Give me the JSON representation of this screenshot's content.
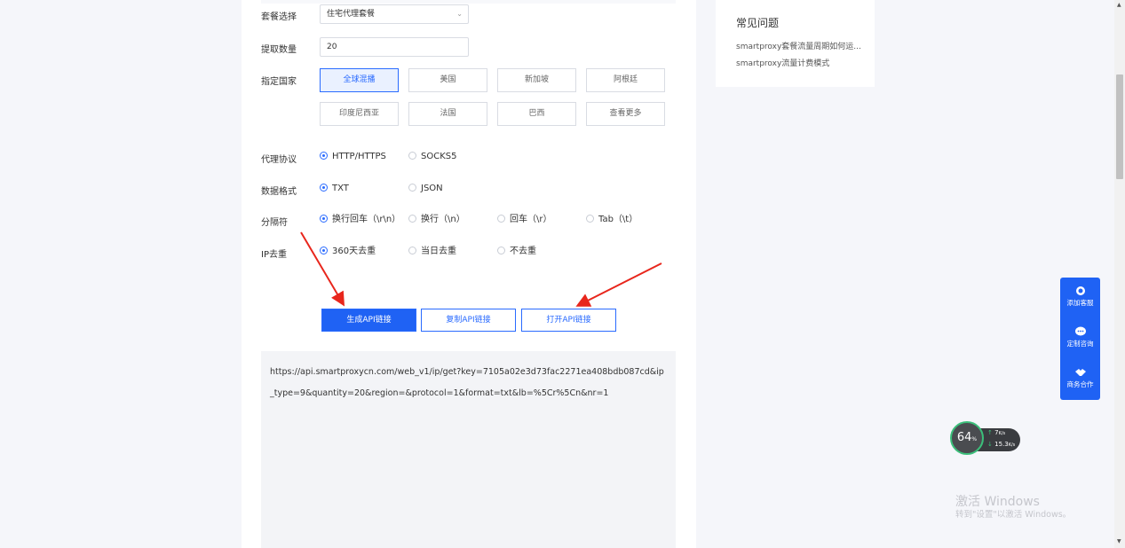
{
  "form": {
    "package_label": "套餐选择",
    "package_value": "住宅代理套餐",
    "qty_label": "提取数量",
    "qty_value": "20",
    "country_label": "指定国家",
    "countries": [
      "全球混播",
      "美国",
      "新加坡",
      "阿根廷",
      "印度尼西亚",
      "法国",
      "巴西",
      "查看更多"
    ],
    "protocol_label": "代理协议",
    "protocol_options": [
      "HTTP/HTTPS",
      "SOCKS5"
    ],
    "format_label": "数据格式",
    "format_options": [
      "TXT",
      "JSON"
    ],
    "separator_label": "分隔符",
    "separator_options": [
      "换行回车（\\r\\n）",
      "换行（\\n）",
      "回车（\\r）",
      "Tab（\\t）"
    ],
    "dedup_label": "IP去重",
    "dedup_options": [
      "360天去重",
      "当日去重",
      "不去重"
    ]
  },
  "actions": {
    "generate": "生成API链接",
    "copy": "复制API链接",
    "open": "打开API链接"
  },
  "result_url": "https://api.smartproxycn.com/web_v1/ip/get?key=7105a02e3d73fac2271ea408bdb087cd&ip_type=9&quantity=20&region=&protocol=1&format=txt&lb=%5Cr%5Cn&nr=1",
  "faq": {
    "title": "常见问题",
    "items": [
      "smartproxy套餐流量周期如何运...",
      "smartproxy流量计费模式"
    ]
  },
  "float_menu": [
    "添加客服",
    "定制咨询",
    "商务合作"
  ],
  "gauge": {
    "percent": "64",
    "unit": "%",
    "up": "7",
    "up_unit": "K/s",
    "down": "15.3",
    "down_unit": "K/s"
  },
  "watermark": {
    "line1": "激活 Windows",
    "line2": "转到\"设置\"以激活 Windows。"
  },
  "colors": {
    "accent": "#1f62f4",
    "annotation": "#e8261c"
  }
}
